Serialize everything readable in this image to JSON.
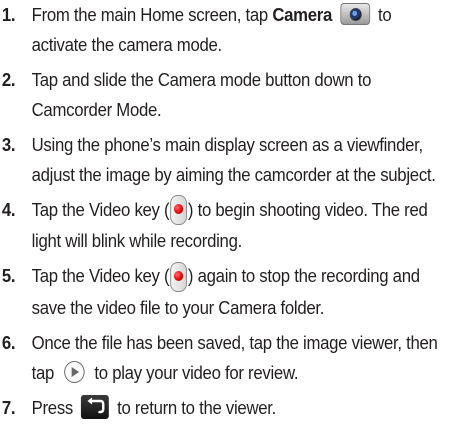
{
  "steps": [
    {
      "number": "1.",
      "parts": [
        "From the main Home screen, tap ",
        "Camera",
        " to activate the camera mode."
      ],
      "icon": "camera-icon"
    },
    {
      "number": "2.",
      "text": "Tap and slide the Camera mode button down to Camcorder Mode."
    },
    {
      "number": "3.",
      "text": "Using the phone’s main display screen as a viewfinder, adjust the image by aiming the camcorder at the subject."
    },
    {
      "number": "4.",
      "parts": [
        "Tap the Video key (",
        ") to begin shooting video. The red light will blink while recording."
      ],
      "icon": "video-key-icon"
    },
    {
      "number": "5.",
      "parts": [
        "Tap the Video key (",
        ") again to stop the recording and save the video file to your Camera folder."
      ],
      "icon": "video-key-icon"
    },
    {
      "number": "6.",
      "parts": [
        "Once the file has been saved, tap the image viewer, then tap ",
        " to play your video for review."
      ],
      "icon": "play-icon"
    },
    {
      "number": "7.",
      "parts": [
        "Press ",
        " to return to the viewer."
      ],
      "icon": "back-icon"
    }
  ]
}
